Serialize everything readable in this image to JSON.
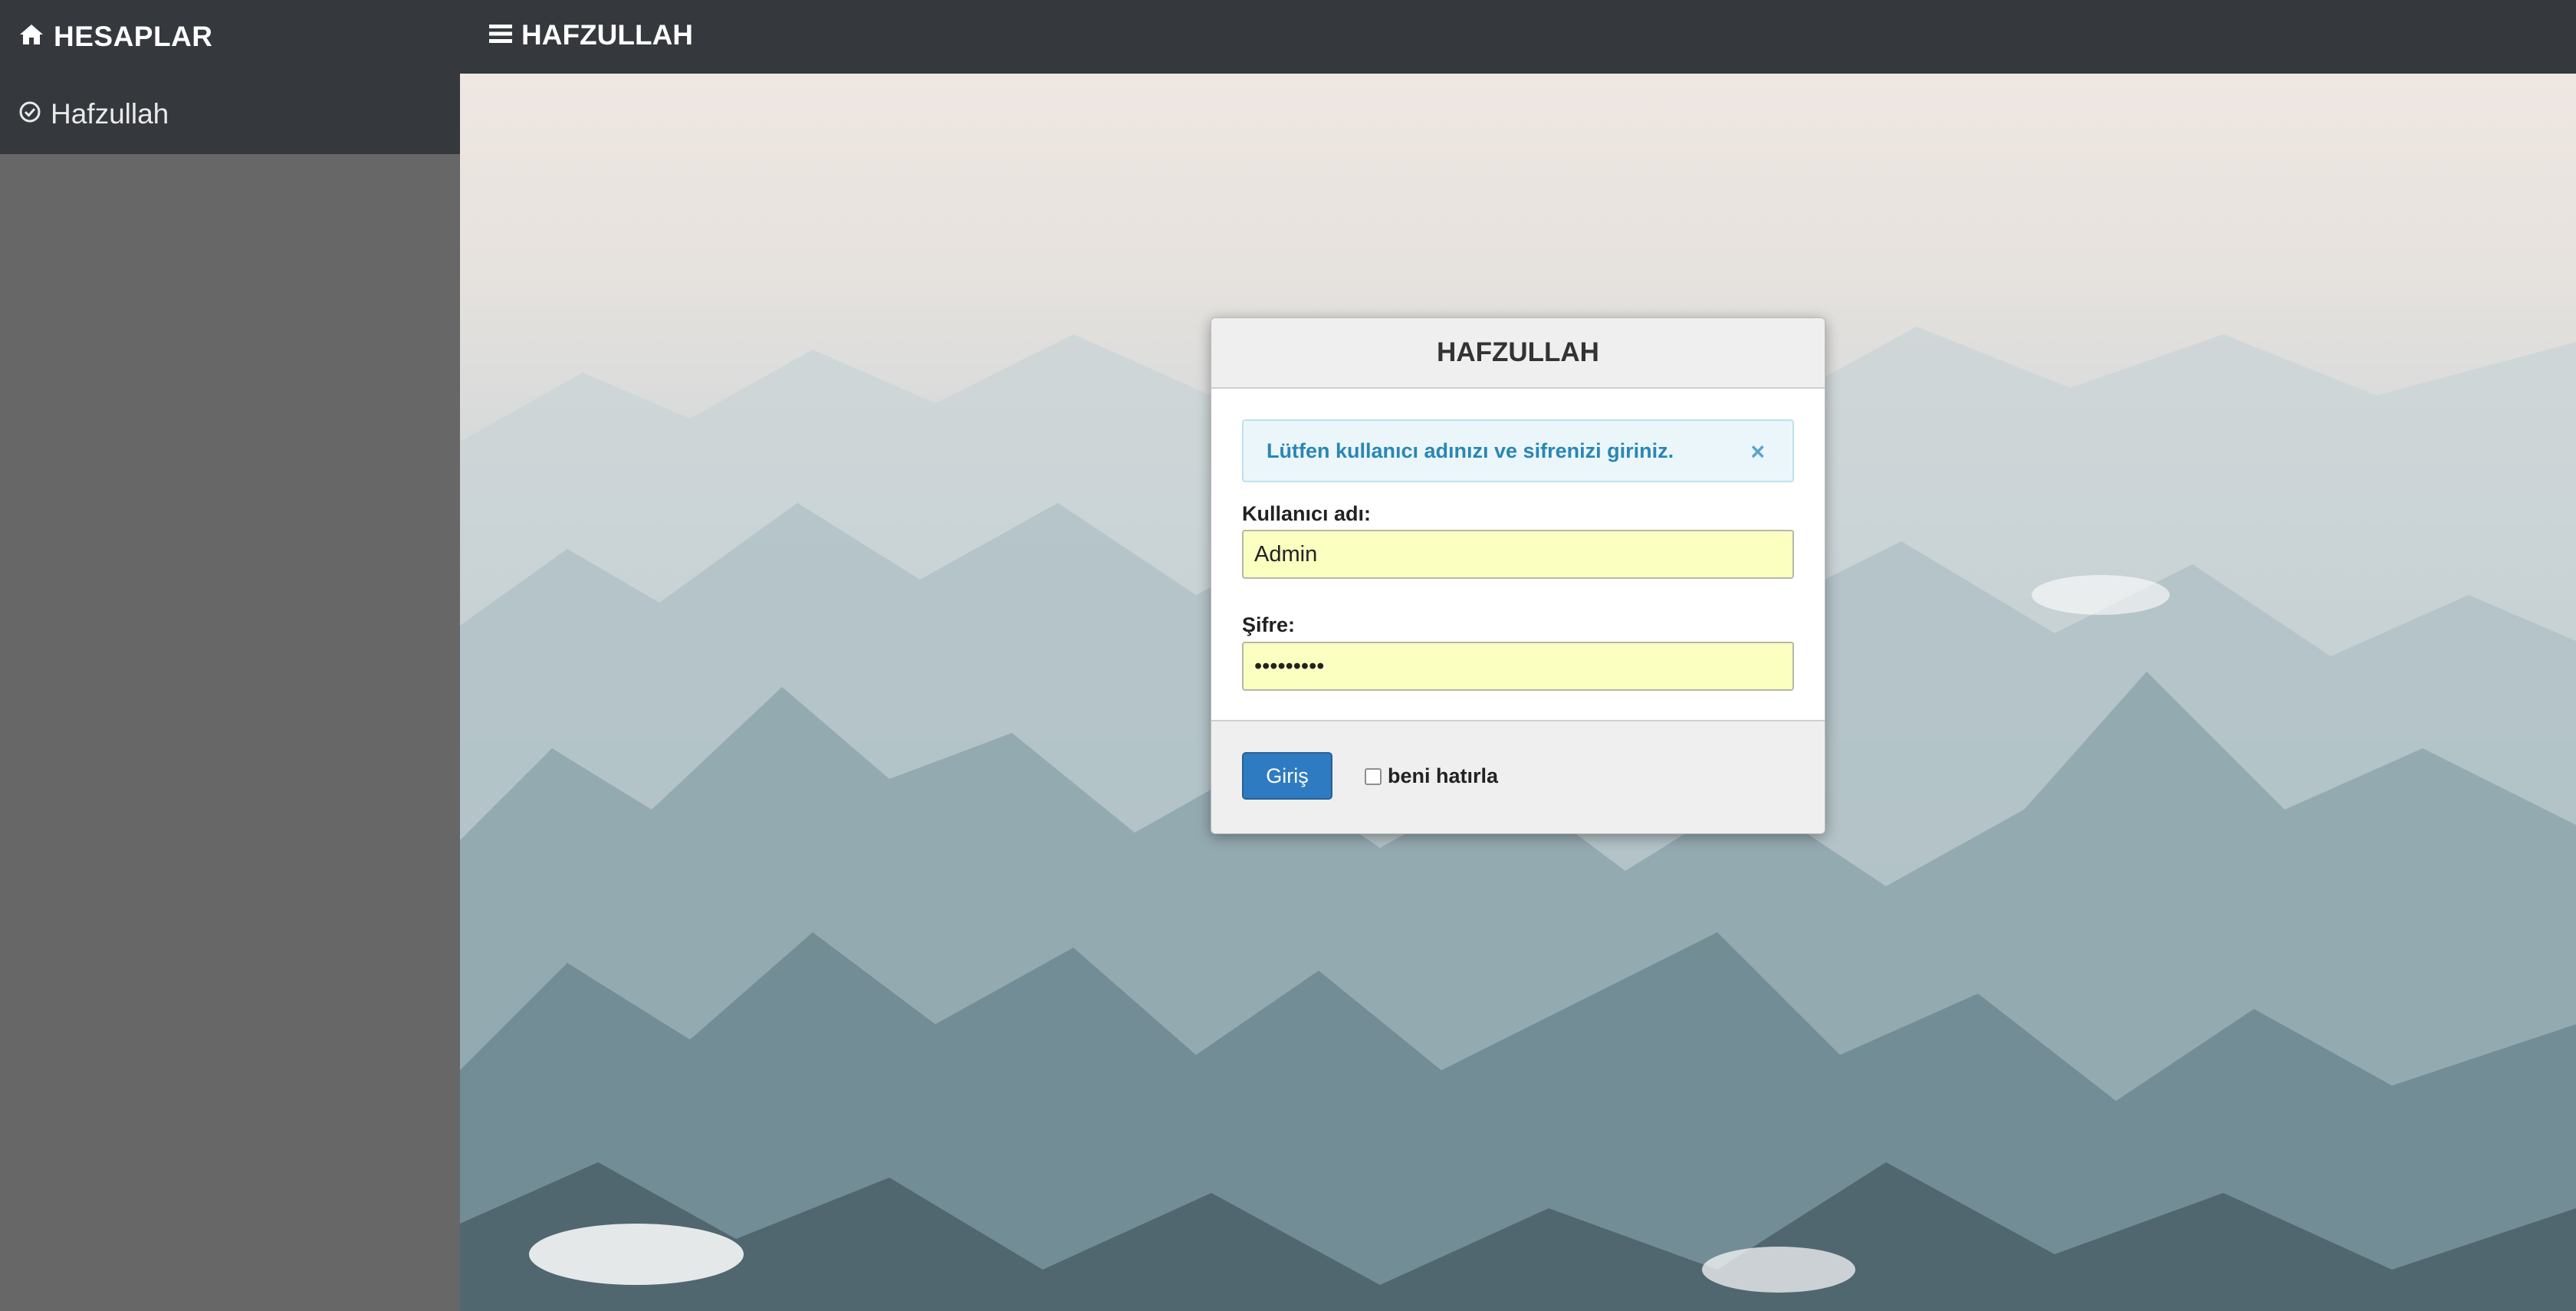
{
  "brand": {
    "label": "HESAPLAR",
    "icon": "home-icon"
  },
  "topnav": {
    "label": "HAFZULLAH",
    "icon": "hamburger-icon"
  },
  "sidebar": {
    "items": [
      {
        "label": "Hafzullah",
        "icon": "check-circle-icon"
      }
    ]
  },
  "login": {
    "title": "HAFZULLAH",
    "alert": "Lütfen kullanıcı adınızı ve sifrenizi giriniz.",
    "alert_close": "×",
    "username_label": "Kullanıcı adı:",
    "username_value": "Admin",
    "password_label": "Şifre:",
    "password_value": "•••••••••",
    "submit_label": "Giriş",
    "remember_label": "beni hatırla"
  },
  "colors": {
    "topbar": "#35383d",
    "sidebar": "#676767",
    "button": "#2f7bc1",
    "input_bg": "#fbffc0",
    "alert_text": "#2a86b4"
  }
}
